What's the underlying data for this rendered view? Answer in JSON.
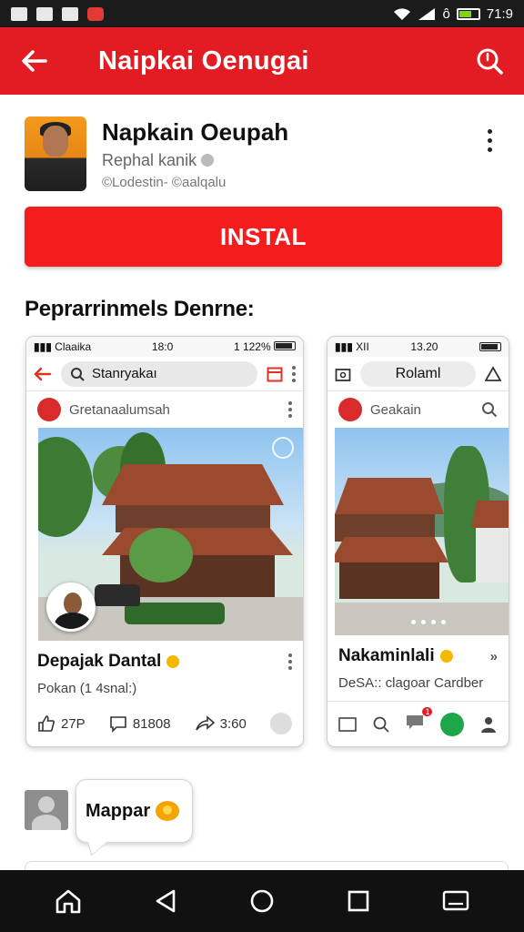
{
  "status_bar": {
    "time": "71:9",
    "signal_text": "ô",
    "icons": [
      "gallery-icon",
      "photo-icon",
      "edit-icon",
      "app-red-icon"
    ]
  },
  "app_bar": {
    "title": "Naipkai Oenugai",
    "back_icon": "arrow-left-icon",
    "search_icon": "search-icon"
  },
  "app": {
    "name": "Napkain Oeupah",
    "developer": "Rephal kanik",
    "meta": "©Lodestin- ©aalqalu",
    "install_label": "INSTAL"
  },
  "screenshots_title": "Peprarrinmels Denrne:",
  "screenshots": [
    {
      "status": {
        "carrier": "Claaika",
        "time": "18:0",
        "battery": "1 122%"
      },
      "search_text": "Stanryakaı",
      "post_author": "Gretanaalumsah",
      "caption_title": "Depajak Dantal",
      "caption_sub": "Pokan (1 4snal:)",
      "actions": {
        "likes": "27P",
        "comments": "81808",
        "shares": "3:60"
      }
    },
    {
      "status": {
        "carrier": "XII",
        "time": "13.20"
      },
      "pill_text": "Rolaml",
      "post_author": "Geakain",
      "caption_title": "Nakaminlali",
      "caption_sub": "DeSA:: clagoar Cardber",
      "nav_badge": "1"
    }
  ],
  "comment": {
    "text": "Mappar"
  },
  "colors": {
    "brand_red": "#e31c23",
    "install_red": "#f41c1c"
  }
}
